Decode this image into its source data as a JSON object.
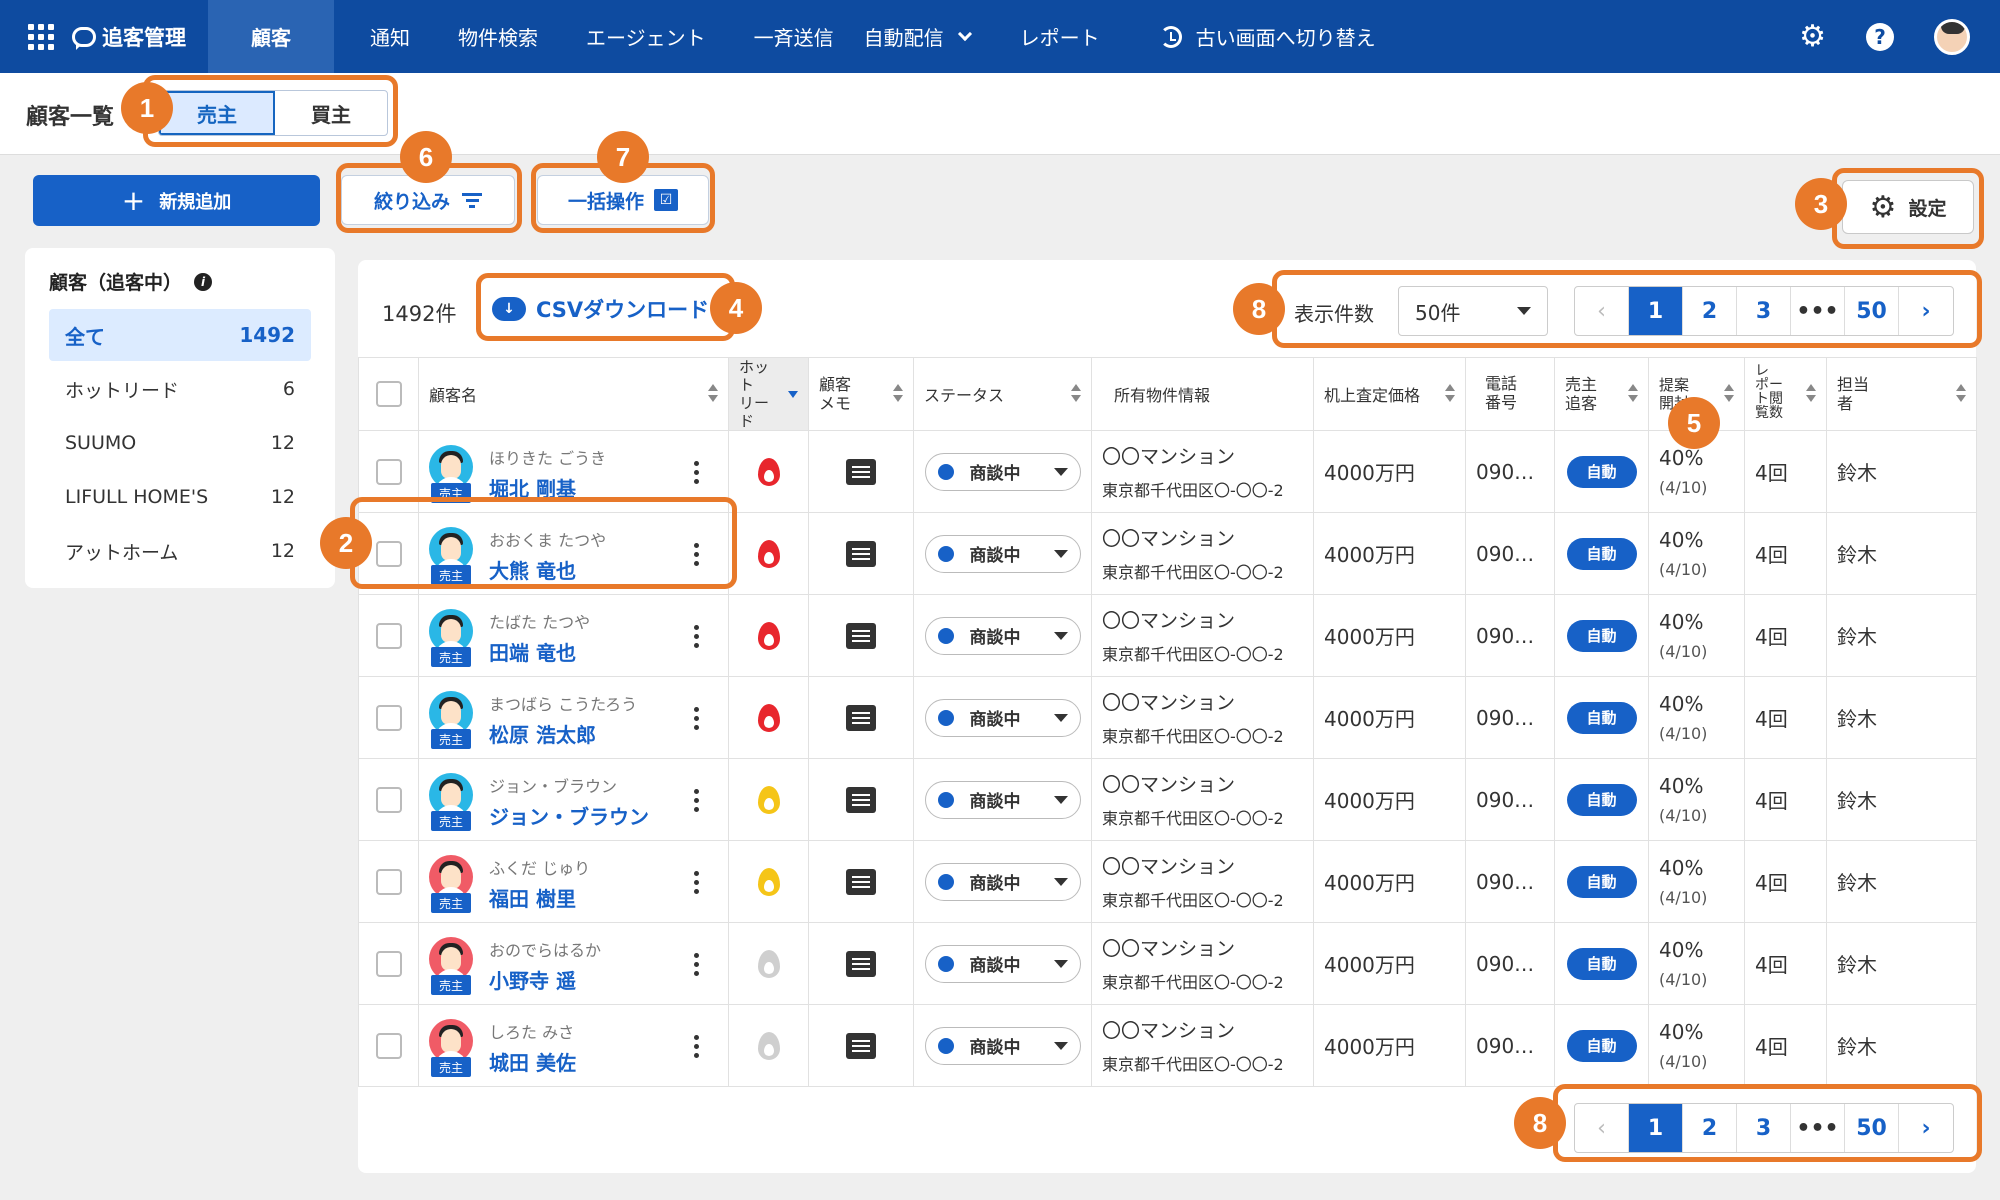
{
  "topnav": {
    "brand": "追客管理",
    "items": [
      "顧客",
      "通知",
      "物件検索",
      "エージェント",
      "一斉送信",
      "自動配信",
      "レポート"
    ],
    "switch_label": "古い画面へ切り替え",
    "help": "?"
  },
  "subheader": {
    "title": "顧客一覧",
    "tabs": [
      "売主",
      "買主"
    ]
  },
  "actions": {
    "add_label": "新規追加",
    "filter_label": "絞り込み",
    "bulk_label": "一括操作",
    "settings_label": "設定"
  },
  "sidebar": {
    "title": "顧客（追客中）",
    "items": [
      {
        "label": "全て",
        "count": "1492"
      },
      {
        "label": "ホットリード",
        "count": "6"
      },
      {
        "label": "SUUMO",
        "count": "12"
      },
      {
        "label": "LIFULL HOME'S",
        "count": "12"
      },
      {
        "label": "アットホーム",
        "count": "12"
      }
    ]
  },
  "list": {
    "count": "1492件",
    "csv_label": "CSVダウンロード",
    "per_page_label": "表示件数",
    "per_page_value": "50件",
    "pages": [
      "1",
      "2",
      "3",
      "•••",
      "50"
    ]
  },
  "table": {
    "headers": {
      "name": "顧客名",
      "hot": "ホット\nリード",
      "memo": "顧客\nメモ",
      "status": "ステータス",
      "property": "所有物件情報",
      "price": "机上査定価格",
      "phone": "電話\n番号",
      "track": "売主\n追客",
      "proposal": "提案\n開封",
      "report": "レ\nポー\nト閲\n覧数",
      "owner": "担当\n者"
    },
    "rows": [
      {
        "kana": "ほりきた ごうき",
        "name": "堀北 剛基",
        "gender": "male",
        "hot": "red"
      },
      {
        "kana": "おおくま たつや",
        "name": "大熊 竜也",
        "gender": "male",
        "hot": "red"
      },
      {
        "kana": "たばた たつや",
        "name": "田端 竜也",
        "gender": "male",
        "hot": "red"
      },
      {
        "kana": "まつばら こうたろう",
        "name": "松原 浩太郎",
        "gender": "male",
        "hot": "red"
      },
      {
        "kana": "ジョン・ブラウン",
        "name": "ジョン・ブラウン",
        "gender": "male",
        "hot": "yellow"
      },
      {
        "kana": "ふくだ じゅり",
        "name": "福田 樹里",
        "gender": "female",
        "hot": "yellow"
      },
      {
        "kana": "おのでらはるか",
        "name": "小野寺 遥",
        "gender": "female",
        "hot": "gray"
      },
      {
        "kana": "しろた みさ",
        "name": "城田 美佐",
        "gender": "female",
        "hot": "gray"
      }
    ],
    "common": {
      "tag": "売主",
      "status": "商談中",
      "property_name": "〇〇マンション",
      "property_address": "東京都千代田区〇-〇〇-2",
      "price": "4000万円",
      "phone": "090…",
      "track": "自動",
      "proposal_pct": "40%",
      "proposal_sub": "(4/10)",
      "report": "4回",
      "owner": "鈴木"
    }
  },
  "annotations": [
    "1",
    "2",
    "3",
    "4",
    "5",
    "6",
    "7",
    "8",
    "8"
  ],
  "colors": {
    "nav": "#0e4ba0",
    "accent": "#1761c7",
    "annotation": "#e8792a",
    "hot_red": "#e8262d",
    "hot_yellow": "#f5c518",
    "hot_gray": "#cfcfcf"
  }
}
